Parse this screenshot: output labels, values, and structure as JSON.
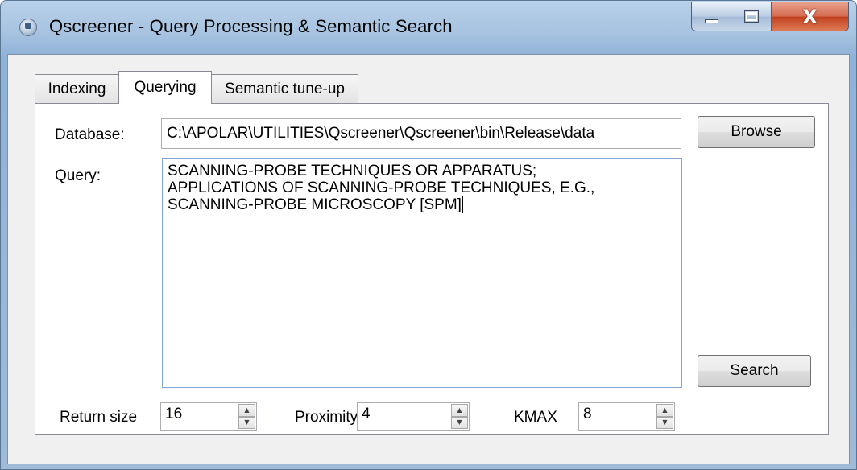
{
  "window": {
    "title": "Qscreener - Query Processing & Semantic Search",
    "close_glyph": "X"
  },
  "tabs": [
    {
      "label": "Indexing"
    },
    {
      "label": "Querying"
    },
    {
      "label": "Semantic tune-up"
    }
  ],
  "active_tab": "Querying",
  "querying": {
    "database_label": "Database:",
    "database_value": "C:\\APOLAR\\UTILITIES\\Qscreener\\Qscreener\\bin\\Release\\data",
    "browse_label": "Browse",
    "query_label": "Query:",
    "query_lines": [
      "SCANNING-PROBE TECHNIQUES OR APPARATUS;",
      "APPLICATIONS OF SCANNING-PROBE TECHNIQUES, E.G.,",
      "SCANNING-PROBE MICROSCOPY [SPM]"
    ],
    "search_label": "Search",
    "return_size_label": "Return size",
    "return_size_value": "16",
    "proximity_label": "Proximity",
    "proximity_value": "4",
    "kmax_label": "KMAX",
    "kmax_value": "8"
  },
  "icons": {
    "app": "app-icon",
    "minimize": "minimize-icon",
    "maximize": "maximize-icon",
    "close": "close-icon",
    "spin_up": "spin-up-icon",
    "spin_down": "spin-down-icon"
  }
}
